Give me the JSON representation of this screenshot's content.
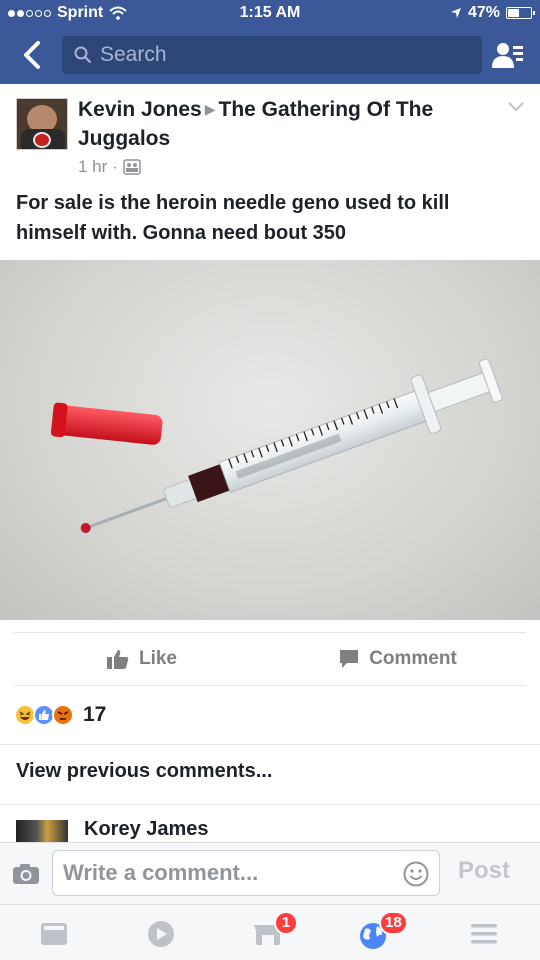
{
  "status_bar": {
    "carrier": "Sprint",
    "time": "1:15 AM",
    "battery": "47%"
  },
  "nav": {
    "search_placeholder": "Search"
  },
  "post": {
    "author": "Kevin Jones",
    "group": "The Gathering Of The Juggalos",
    "time": "1 hr",
    "text": "For sale is the heroin needle geno used to kill himself with. Gonna need bout 350"
  },
  "actions": {
    "like_label": "Like",
    "comment_label": "Comment"
  },
  "reactions": {
    "types": [
      "haha",
      "like",
      "angry"
    ],
    "count": "17"
  },
  "comments": {
    "view_previous": "View previous comments...",
    "first_commenter": "Korey James"
  },
  "compose": {
    "placeholder": "Write a comment...",
    "post_label": "Post"
  },
  "tab_bar": {
    "tabs": [
      {
        "icon": "news-feed-icon"
      },
      {
        "icon": "video-icon"
      },
      {
        "icon": "marketplace-icon",
        "badge": "1"
      },
      {
        "icon": "notifications-globe-icon",
        "badge": "18"
      },
      {
        "icon": "menu-icon"
      }
    ]
  },
  "colors": {
    "brand": "#3b5998",
    "badge": "#fa3e3e"
  }
}
